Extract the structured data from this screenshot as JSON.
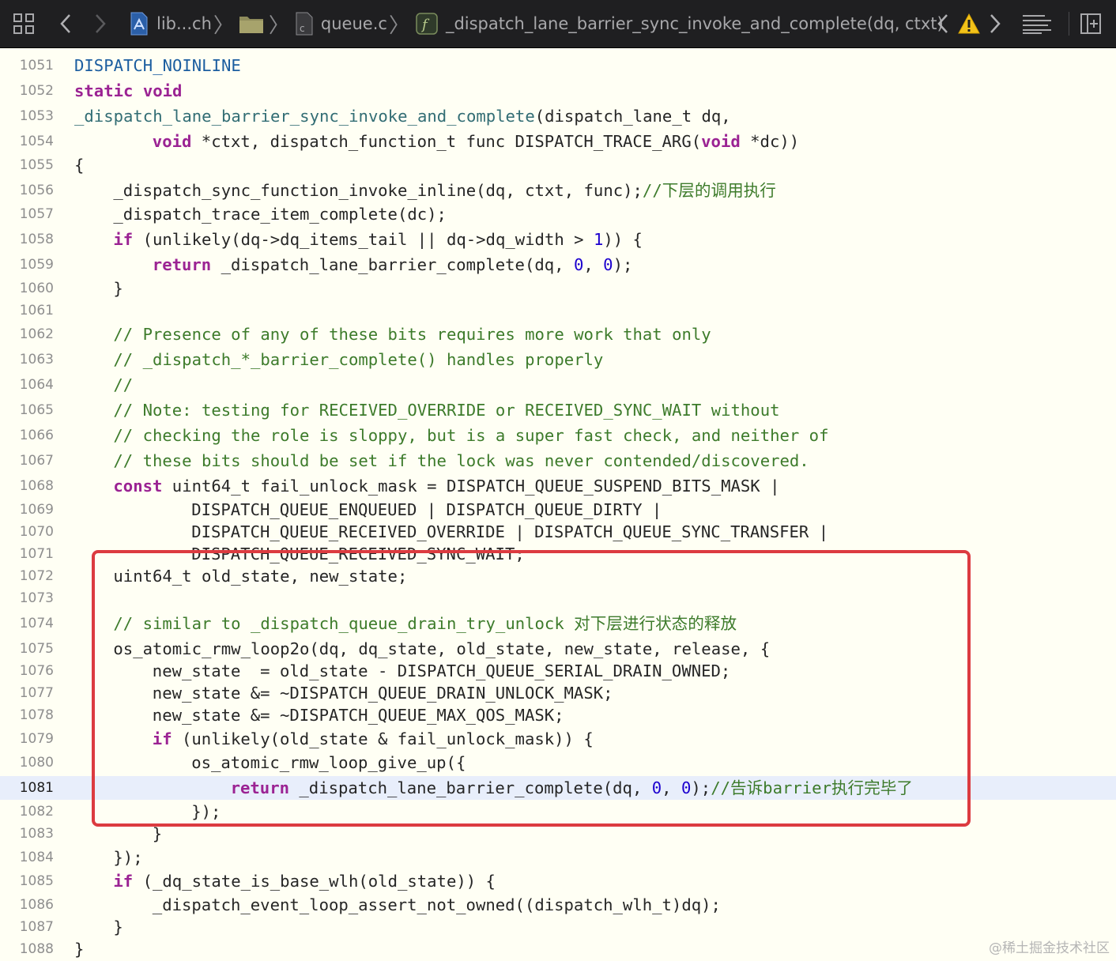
{
  "breadcrumb": {
    "project": "lib...ch",
    "file": "queue.c",
    "symbol": "_dispatch_lane_barrier_sync_invoke_and_complete(dq, ctxt)",
    "separator": "〉"
  },
  "icons": {
    "grid": "related-items-grid-icon",
    "back": "chevron-left-icon",
    "forward": "chevron-right-icon",
    "project": "project-file-icon",
    "folder": "folder-icon",
    "cfile": "c-file-icon",
    "function": "function-symbol-icon",
    "prev_issue": "chevron-left-icon",
    "warning": "warning-triangle-icon",
    "next_issue": "chevron-right-icon",
    "minimap": "minimap-lines-icon",
    "add_editor": "add-editor-pane-icon"
  },
  "colors": {
    "keyword": "#9b2393",
    "comment": "#3d7b2b",
    "function": "#326d74",
    "macro": "#1c5ea0",
    "number": "#1c00cf",
    "highlight_border": "#dc3b40",
    "current_line": "#e8eefb"
  },
  "current_line": 1081,
  "highlighted_range": [
    1074,
    1084
  ],
  "code_lines": [
    {
      "n": "1051",
      "indent": 0,
      "tokens": [
        [
          "mac",
          "DISPATCH_NOINLINE"
        ]
      ]
    },
    {
      "n": "1052",
      "indent": 0,
      "tokens": [
        [
          "kw",
          "static"
        ],
        [
          "pl",
          " "
        ],
        [
          "kw",
          "void"
        ]
      ]
    },
    {
      "n": "1053",
      "indent": 0,
      "tokens": [
        [
          "fn",
          "_dispatch_lane_barrier_sync_invoke_and_complete"
        ],
        [
          "pl",
          "(dispatch_lane_t dq,"
        ]
      ]
    },
    {
      "n": "1054",
      "indent": 8,
      "tokens": [
        [
          "kw",
          "void"
        ],
        [
          "pl",
          " *ctxt, dispatch_function_t func DISPATCH_TRACE_ARG("
        ],
        [
          "kw",
          "void"
        ],
        [
          "pl",
          " *dc))"
        ]
      ]
    },
    {
      "n": "1055",
      "indent": 0,
      "tokens": [
        [
          "pl",
          "{"
        ]
      ]
    },
    {
      "n": "1056",
      "indent": 4,
      "tokens": [
        [
          "pl",
          "_dispatch_sync_function_invoke_inline(dq, ctxt, func);"
        ],
        [
          "cm",
          "//下层的调用执行"
        ]
      ]
    },
    {
      "n": "1057",
      "indent": 4,
      "tokens": [
        [
          "pl",
          "_dispatch_trace_item_complete(dc);"
        ]
      ]
    },
    {
      "n": "1058",
      "indent": 4,
      "tokens": [
        [
          "kw",
          "if"
        ],
        [
          "pl",
          " (unlikely(dq->dq_items_tail || dq->dq_width > "
        ],
        [
          "num",
          "1"
        ],
        [
          "pl",
          ")) {"
        ]
      ]
    },
    {
      "n": "1059",
      "indent": 8,
      "tokens": [
        [
          "kw",
          "return"
        ],
        [
          "pl",
          " _dispatch_lane_barrier_complete(dq, "
        ],
        [
          "num",
          "0"
        ],
        [
          "pl",
          ", "
        ],
        [
          "num",
          "0"
        ],
        [
          "pl",
          ");"
        ]
      ]
    },
    {
      "n": "1060",
      "indent": 4,
      "tokens": [
        [
          "pl",
          "}"
        ]
      ]
    },
    {
      "n": "1061",
      "indent": 0,
      "tokens": []
    },
    {
      "n": "1062",
      "indent": 4,
      "tokens": [
        [
          "cm",
          "// Presence of any of these bits requires more work that only"
        ]
      ]
    },
    {
      "n": "1063",
      "indent": 4,
      "tokens": [
        [
          "cm",
          "// _dispatch_*_barrier_complete() handles properly"
        ]
      ]
    },
    {
      "n": "1064",
      "indent": 4,
      "tokens": [
        [
          "cm",
          "//"
        ]
      ]
    },
    {
      "n": "1065",
      "indent": 4,
      "tokens": [
        [
          "cm",
          "// Note: testing for RECEIVED_OVERRIDE or RECEIVED_SYNC_WAIT without"
        ]
      ]
    },
    {
      "n": "1066",
      "indent": 4,
      "tokens": [
        [
          "cm",
          "// checking the role is sloppy, but is a super fast check, and neither of"
        ]
      ]
    },
    {
      "n": "1067",
      "indent": 4,
      "tokens": [
        [
          "cm",
          "// these bits should be set if the lock was never contended/discovered."
        ]
      ]
    },
    {
      "n": "1068",
      "indent": 4,
      "tokens": [
        [
          "kw",
          "const"
        ],
        [
          "pl",
          " uint64_t fail_unlock_mask = DISPATCH_QUEUE_SUSPEND_BITS_MASK |"
        ]
      ]
    },
    {
      "n": "1069",
      "indent": 12,
      "tokens": [
        [
          "pl",
          "DISPATCH_QUEUE_ENQUEUED | DISPATCH_QUEUE_DIRTY |"
        ]
      ]
    },
    {
      "n": "1070",
      "indent": 12,
      "tokens": [
        [
          "pl",
          "DISPATCH_QUEUE_RECEIVED_OVERRIDE | DISPATCH_QUEUE_SYNC_TRANSFER |"
        ]
      ]
    },
    {
      "n": "1071",
      "indent": 12,
      "tokens": [
        [
          "pl",
          "DISPATCH_QUEUE_RECEIVED_SYNC_WAIT;"
        ]
      ]
    },
    {
      "n": "1072",
      "indent": 4,
      "tokens": [
        [
          "pl",
          "uint64_t old_state, new_state;"
        ]
      ]
    },
    {
      "n": "1073",
      "indent": 0,
      "tokens": []
    },
    {
      "n": "1074",
      "indent": 4,
      "tokens": [
        [
          "cm",
          "// similar to _dispatch_queue_drain_try_unlock 对下层进行状态的释放"
        ]
      ]
    },
    {
      "n": "1075",
      "indent": 4,
      "tokens": [
        [
          "pl",
          "os_atomic_rmw_loop2o(dq, dq_state, old_state, new_state, release, {"
        ]
      ]
    },
    {
      "n": "1076",
      "indent": 8,
      "tokens": [
        [
          "pl",
          "new_state  = old_state - DISPATCH_QUEUE_SERIAL_DRAIN_OWNED;"
        ]
      ]
    },
    {
      "n": "1077",
      "indent": 8,
      "tokens": [
        [
          "pl",
          "new_state &= ~DISPATCH_QUEUE_DRAIN_UNLOCK_MASK;"
        ]
      ]
    },
    {
      "n": "1078",
      "indent": 8,
      "tokens": [
        [
          "pl",
          "new_state &= ~DISPATCH_QUEUE_MAX_QOS_MASK;"
        ]
      ]
    },
    {
      "n": "1079",
      "indent": 8,
      "tokens": [
        [
          "kw",
          "if"
        ],
        [
          "pl",
          " (unlikely(old_state & fail_unlock_mask)) {"
        ]
      ]
    },
    {
      "n": "1080",
      "indent": 12,
      "tokens": [
        [
          "pl",
          "os_atomic_rmw_loop_give_up({"
        ]
      ]
    },
    {
      "n": "1081",
      "indent": 16,
      "tokens": [
        [
          "kw",
          "return"
        ],
        [
          "pl",
          " _dispatch_lane_barrier_complete(dq, "
        ],
        [
          "num",
          "0"
        ],
        [
          "pl",
          ", "
        ],
        [
          "num",
          "0"
        ],
        [
          "pl",
          ");"
        ],
        [
          "cm",
          "//告诉barrier执行完毕了"
        ]
      ]
    },
    {
      "n": "1082",
      "indent": 12,
      "tokens": [
        [
          "pl",
          "});"
        ]
      ]
    },
    {
      "n": "1083",
      "indent": 8,
      "tokens": [
        [
          "pl",
          "}"
        ]
      ]
    },
    {
      "n": "1084",
      "indent": 4,
      "tokens": [
        [
          "pl",
          "});"
        ]
      ]
    },
    {
      "n": "1085",
      "indent": 4,
      "tokens": [
        [
          "kw",
          "if"
        ],
        [
          "pl",
          " (_dq_state_is_base_wlh(old_state)) {"
        ]
      ]
    },
    {
      "n": "1086",
      "indent": 8,
      "tokens": [
        [
          "pl",
          "_dispatch_event_loop_assert_not_owned((dispatch_wlh_t)dq);"
        ]
      ]
    },
    {
      "n": "1087",
      "indent": 4,
      "tokens": [
        [
          "pl",
          "}"
        ]
      ]
    },
    {
      "n": "1088",
      "indent": 0,
      "tokens": [
        [
          "pl",
          "}"
        ]
      ]
    }
  ],
  "watermark": "@稀土掘金技术社区"
}
